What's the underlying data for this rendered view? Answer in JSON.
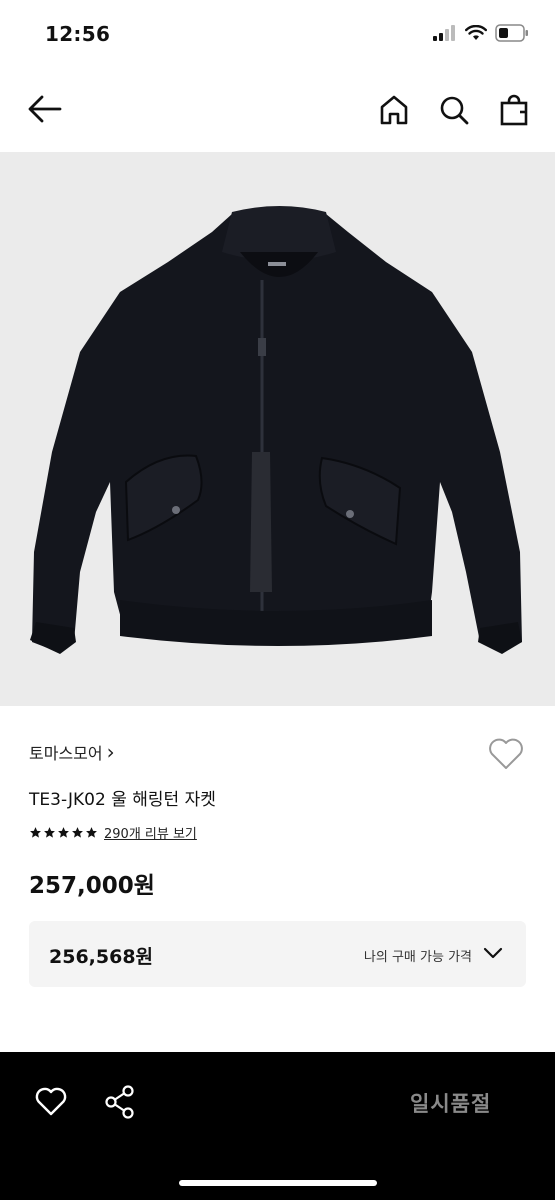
{
  "status_bar": {
    "time": "12:56"
  },
  "nav": {
    "back_icon": "arrow-left-icon",
    "home_icon": "home-icon",
    "search_icon": "search-icon",
    "bag_icon": "shopping-bag-icon"
  },
  "product": {
    "image_alt": "jacket-photo",
    "brand": "토마스모어",
    "brand_chevron": "›",
    "name": "TE3-JK02 울 해링턴 자켓",
    "rating_stars": 5,
    "review_link": "290개 리뷰 보기",
    "price": "257,000원"
  },
  "my_price": {
    "value": "256,568원",
    "label": "나의 구매 가능 가격"
  },
  "bottom_bar": {
    "heart_icon": "heart-icon",
    "share_icon": "share-icon",
    "soldout_label": "일시품절"
  },
  "colors": {
    "background": "#ffffff",
    "image_bg": "#ebebeb",
    "box_bg": "#f4f4f4",
    "bottom_bar": "#000000",
    "soldout_text": "#8a8a8a"
  }
}
